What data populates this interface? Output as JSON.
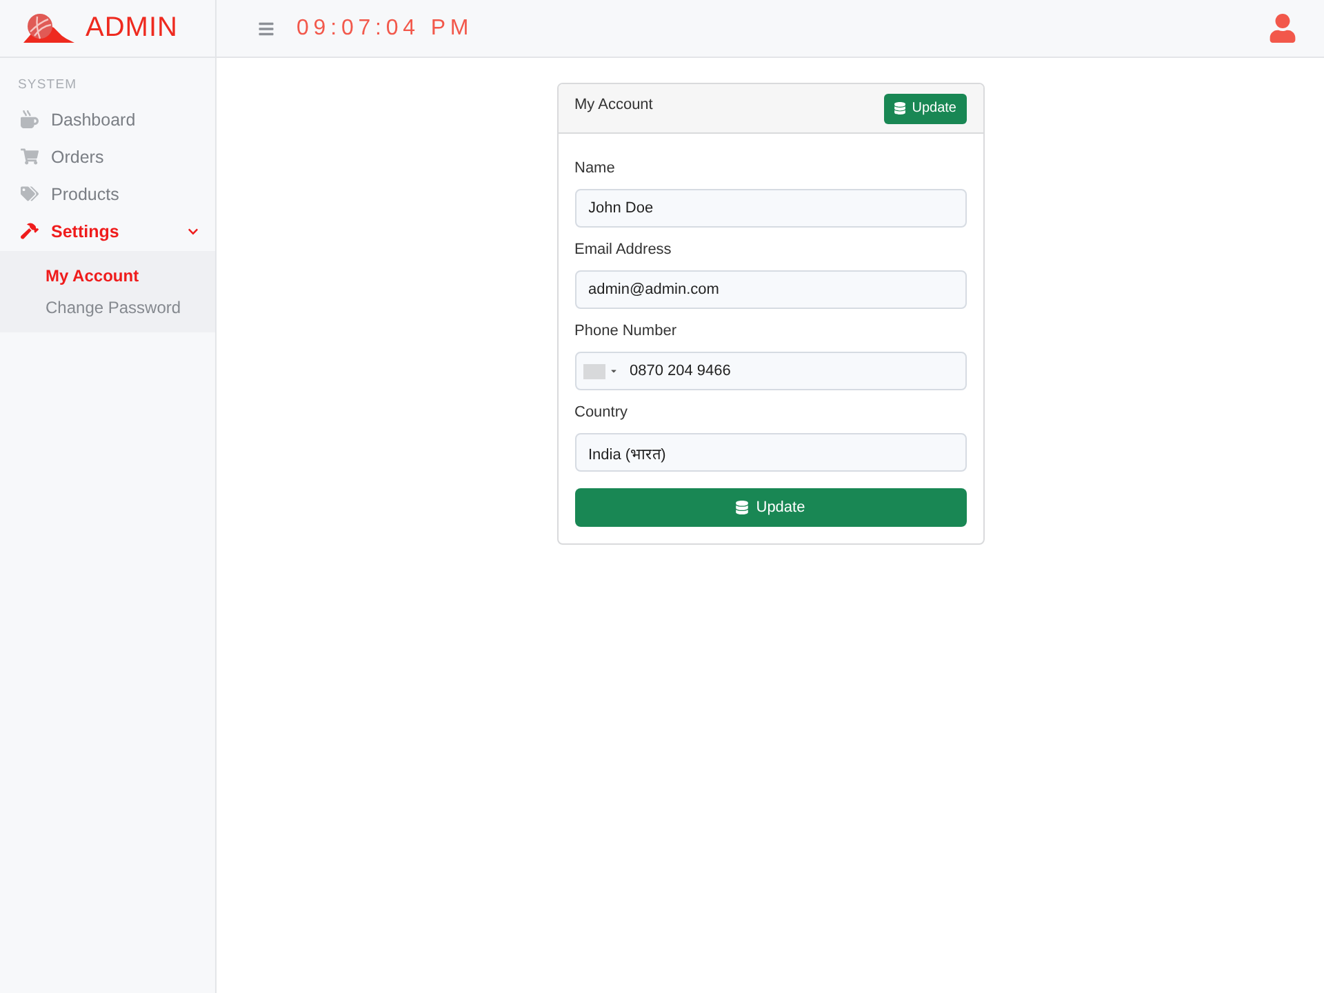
{
  "brand": {
    "name": "ADMIN"
  },
  "topbar": {
    "clock": "09:07:04 PM"
  },
  "sidebar": {
    "section": "SYSTEM",
    "items": [
      {
        "label": "Dashboard",
        "selected": false
      },
      {
        "label": "Orders",
        "selected": false
      },
      {
        "label": "Products",
        "selected": false
      },
      {
        "label": "Settings",
        "selected": true,
        "expanded": true,
        "children": [
          {
            "label": "My Account",
            "selected": true
          },
          {
            "label": "Change Password",
            "selected": false
          }
        ]
      }
    ]
  },
  "card": {
    "title": "My Account",
    "header_button": "Update",
    "fields": [
      {
        "kind": "text",
        "label": "Name",
        "value": "John Doe"
      },
      {
        "kind": "text",
        "label": "Email Address",
        "value": "admin@admin.com"
      },
      {
        "kind": "phone",
        "label": "Phone Number",
        "value": "0870 204 9466"
      },
      {
        "kind": "text",
        "label": "Country",
        "value": "India (भारत)"
      }
    ],
    "submit": "Update"
  }
}
